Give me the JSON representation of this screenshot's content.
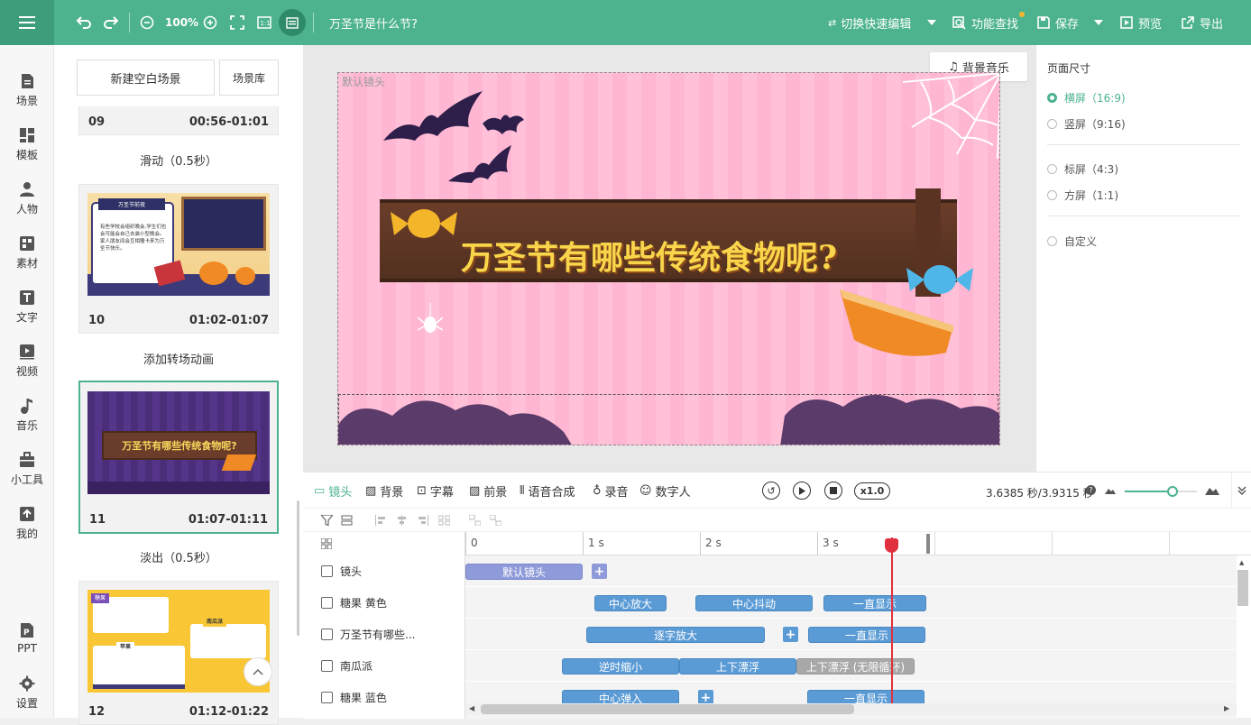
{
  "topbar": {
    "zoom": "100%",
    "doc_title": "万圣节是什么节?",
    "switch_edit": "切换快速编辑",
    "find": "功能查找",
    "save": "保存",
    "preview": "预览",
    "export": "导出"
  },
  "nav": [
    {
      "label": "场景",
      "icon": "scene-icon"
    },
    {
      "label": "模板",
      "icon": "template-icon"
    },
    {
      "label": "人物",
      "icon": "person-icon"
    },
    {
      "label": "素材",
      "icon": "material-icon"
    },
    {
      "label": "文字",
      "icon": "text-icon"
    },
    {
      "label": "视频",
      "icon": "video-icon"
    },
    {
      "label": "音乐",
      "icon": "music-icon"
    },
    {
      "label": "小工具",
      "icon": "toolbox-icon"
    },
    {
      "label": "我的",
      "icon": "upload-icon"
    },
    {
      "label": "PPT",
      "icon": "ppt-icon"
    },
    {
      "label": "设置",
      "icon": "gear-icon"
    }
  ],
  "scenes_panel": {
    "new_blank": "新建空白场景",
    "library": "场景库",
    "scenes": [
      {
        "num": "09",
        "time": "00:56-01:01"
      },
      {
        "num": "10",
        "time": "01:02-01:07"
      },
      {
        "num": "11",
        "time": "01:07-01:11"
      },
      {
        "num": "12",
        "time": "01:12-01:22"
      }
    ],
    "transitions": [
      "滑动（0.5秒）",
      "添加转场动画",
      "淡出（0.5秒）"
    ],
    "thumb10": {
      "title": "万圣节前夜",
      "text": "有些学校会组织晚会,学生们也会可能会自己去装小型晚会。家人朋友间会互相赠卡来为万圣节快乐。"
    },
    "thumb11": {
      "title": "万圣节有哪些传统食物呢?"
    },
    "thumb12": {
      "t1": "糖果",
      "t2": "南瓜派",
      "t3": "苹果"
    }
  },
  "canvas": {
    "camera_label": "默认镜头",
    "bgm": "背景音乐",
    "slide_title": "万圣节有哪些传统食物呢?"
  },
  "page_size": {
    "title": "页面尺寸",
    "options": [
      "横屏（16:9)",
      "竖屏（9:16)",
      "标屏（4:3)",
      "方屏（1:1)",
      "自定义"
    ],
    "selected_index": 0
  },
  "timeline": {
    "tabs": [
      "镜头",
      "背景",
      "字幕",
      "前景",
      "语音合成",
      "录音",
      "数字人"
    ],
    "speed": "x1.0",
    "time_readout": "3.6385 秒/3.9315 秒",
    "ruler": [
      "0",
      "1 s",
      "2 s",
      "3 s"
    ],
    "rows": [
      {
        "label": "镜头",
        "clips": [
          "默认镜头"
        ]
      },
      {
        "label": "糖果 黄色",
        "clips": [
          "中心放大",
          "中心抖动",
          "一直显示"
        ]
      },
      {
        "label": "万圣节有哪些...",
        "clips": [
          "逐字放大",
          "一直显示"
        ]
      },
      {
        "label": "南瓜派",
        "clips": [
          "逆时缩小",
          "上下漂浮",
          "上下漂浮 (无限循环)"
        ]
      },
      {
        "label": "糖果 蓝色",
        "clips": [
          "中心弹入",
          "一直显示"
        ]
      }
    ],
    "plus": "+"
  },
  "colors": {
    "accent": "#4db38e",
    "clip": "#5b9bd5",
    "playhead": "#e0303e",
    "slide_bg": "#ffc0d8"
  }
}
